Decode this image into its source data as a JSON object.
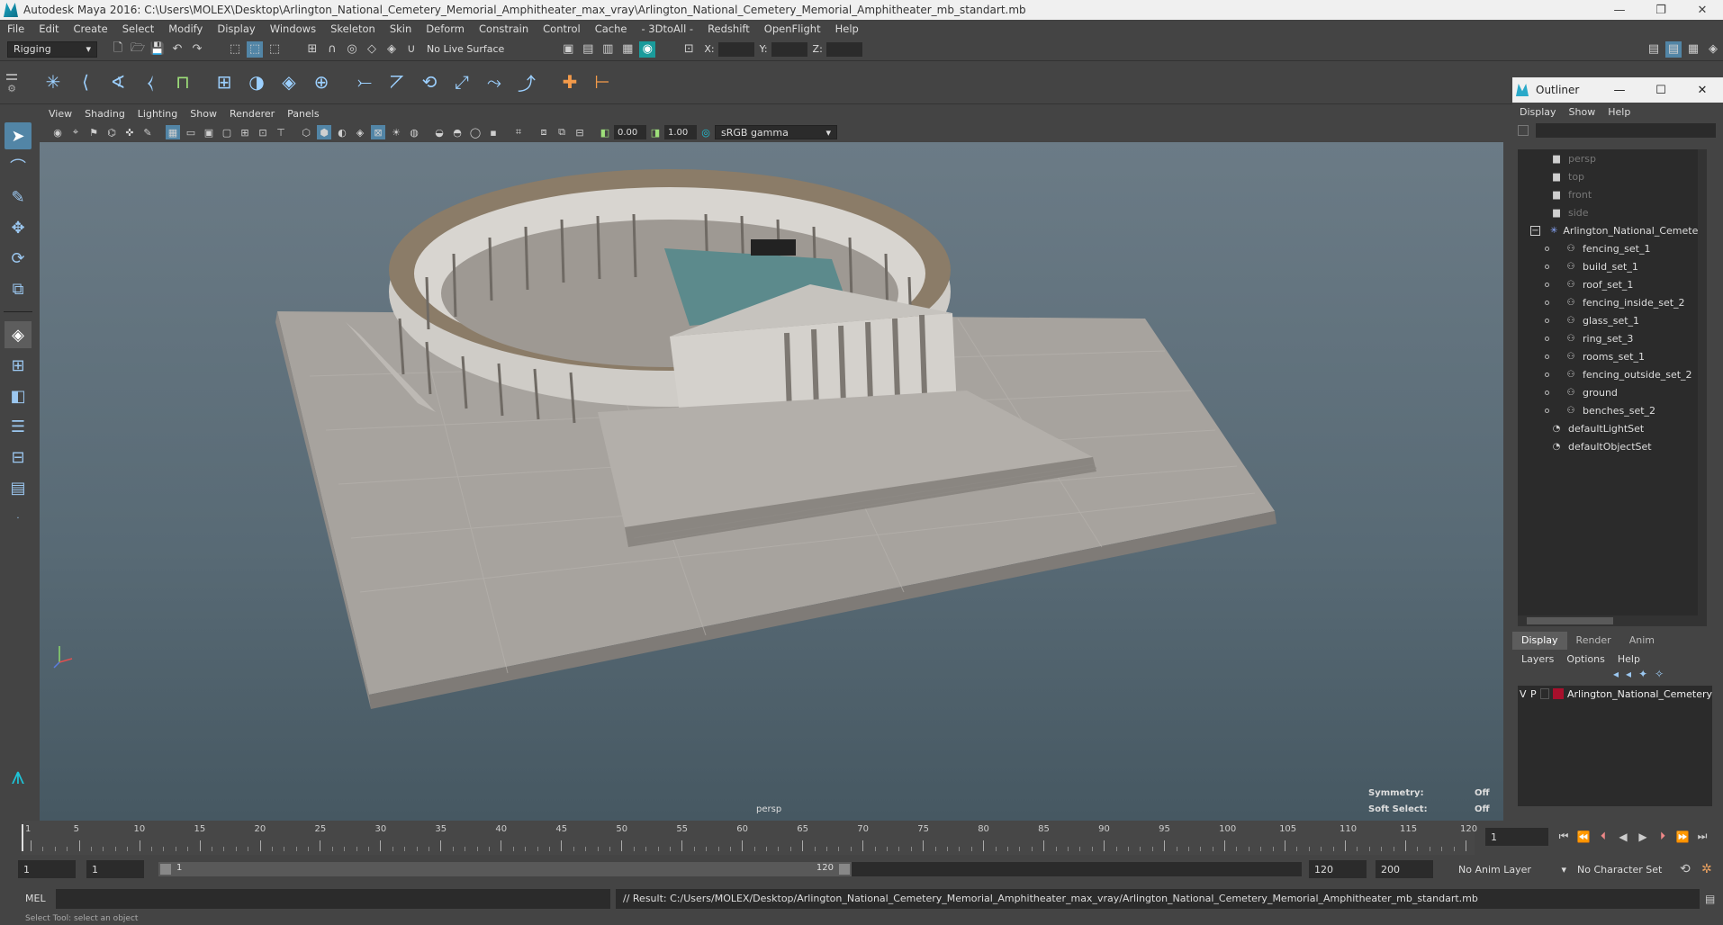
{
  "window": {
    "title": "Autodesk Maya 2016: C:\\Users\\MOLEX\\Desktop\\Arlington_National_Cemetery_Memorial_Amphitheater_max_vray\\Arlington_National_Cemetery_Memorial_Amphitheater_mb_standart.mb",
    "minimize": "—",
    "maximize": "❐",
    "close": "✕"
  },
  "menubar": [
    "File",
    "Edit",
    "Create",
    "Select",
    "Modify",
    "Display",
    "Windows",
    "Skeleton",
    "Skin",
    "Deform",
    "Constrain",
    "Control",
    "Cache",
    "- 3DtoAll -",
    "Redshift",
    "OpenFlight",
    "Help"
  ],
  "statusline": {
    "mode": "Rigging",
    "live_surface": "No Live Surface",
    "x_label": "X:",
    "y_label": "Y:",
    "z_label": "Z:"
  },
  "viewport": {
    "menu": [
      "View",
      "Shading",
      "Lighting",
      "Show",
      "Renderer",
      "Panels"
    ],
    "exposure": "0.00",
    "gamma": "1.00",
    "colorspace": "sRGB gamma",
    "camera_label": "persp",
    "symmetry_label": "Symmetry:",
    "symmetry_value": "Off",
    "soft_select_label": "Soft Select:",
    "soft_select_value": "Off"
  },
  "outliner": {
    "title": "Outliner",
    "menu": [
      "Display",
      "Show",
      "Help"
    ],
    "items": [
      {
        "label": "persp",
        "icon": "camera-icon",
        "kind": "cam",
        "indent": 36
      },
      {
        "label": "top",
        "icon": "camera-icon",
        "kind": "cam",
        "indent": 36
      },
      {
        "label": "front",
        "icon": "camera-icon",
        "kind": "cam",
        "indent": 36
      },
      {
        "label": "side",
        "icon": "camera-icon",
        "kind": "cam",
        "indent": 36
      },
      {
        "label": "Arlington_National_Cemetery",
        "icon": "group-icon",
        "kind": "group",
        "indent": 36
      },
      {
        "label": "fencing_set_1",
        "icon": "set-icon",
        "kind": "child",
        "indent": 52
      },
      {
        "label": "build_set_1",
        "icon": "set-icon",
        "kind": "child",
        "indent": 52
      },
      {
        "label": "roof_set_1",
        "icon": "set-icon",
        "kind": "child",
        "indent": 52
      },
      {
        "label": "fencing_inside_set_2",
        "icon": "set-icon",
        "kind": "child",
        "indent": 52
      },
      {
        "label": "glass_set_1",
        "icon": "set-icon",
        "kind": "child",
        "indent": 52
      },
      {
        "label": "ring_set_3",
        "icon": "set-icon",
        "kind": "child",
        "indent": 52
      },
      {
        "label": "rooms_set_1",
        "icon": "set-icon",
        "kind": "child",
        "indent": 52
      },
      {
        "label": "fencing_outside_set_2",
        "icon": "set-icon",
        "kind": "child",
        "indent": 52
      },
      {
        "label": "ground",
        "icon": "set-icon",
        "kind": "child",
        "indent": 52
      },
      {
        "label": "benches_set_2",
        "icon": "set-icon",
        "kind": "child",
        "indent": 52
      },
      {
        "label": "defaultLightSet",
        "icon": "object-set-icon",
        "kind": "set",
        "indent": 36
      },
      {
        "label": "defaultObjectSet",
        "icon": "object-set-icon",
        "kind": "set",
        "indent": 36
      }
    ]
  },
  "layers": {
    "tabs": [
      "Display",
      "Render",
      "Anim"
    ],
    "menu": [
      "Layers",
      "Options",
      "Help"
    ],
    "rows": [
      {
        "v": "V",
        "p": "P",
        "name": "Arlington_National_Cemetery",
        "color": "#a8102c"
      }
    ]
  },
  "timeline": {
    "ticks": [
      1,
      5,
      10,
      15,
      20,
      25,
      30,
      35,
      40,
      45,
      50,
      55,
      60,
      65,
      70,
      75,
      80,
      85,
      90,
      95,
      100,
      105,
      110,
      115,
      120
    ],
    "current_frame": "1"
  },
  "range": {
    "start": "1",
    "playback_start": "1",
    "slider_start": "1",
    "slider_end": "120",
    "playback_end": "120",
    "end": "200",
    "anim_layer": "No Anim Layer",
    "character_set": "No Character Set"
  },
  "command": {
    "label": "MEL",
    "result": "// Result: C:/Users/MOLEX/Desktop/Arlington_National_Cemetery_Memorial_Amphitheater_max_vray/Arlington_National_Cemetery_Memorial_Amphitheater_mb_standart.mb"
  },
  "help_line": "Select Tool: select an object"
}
